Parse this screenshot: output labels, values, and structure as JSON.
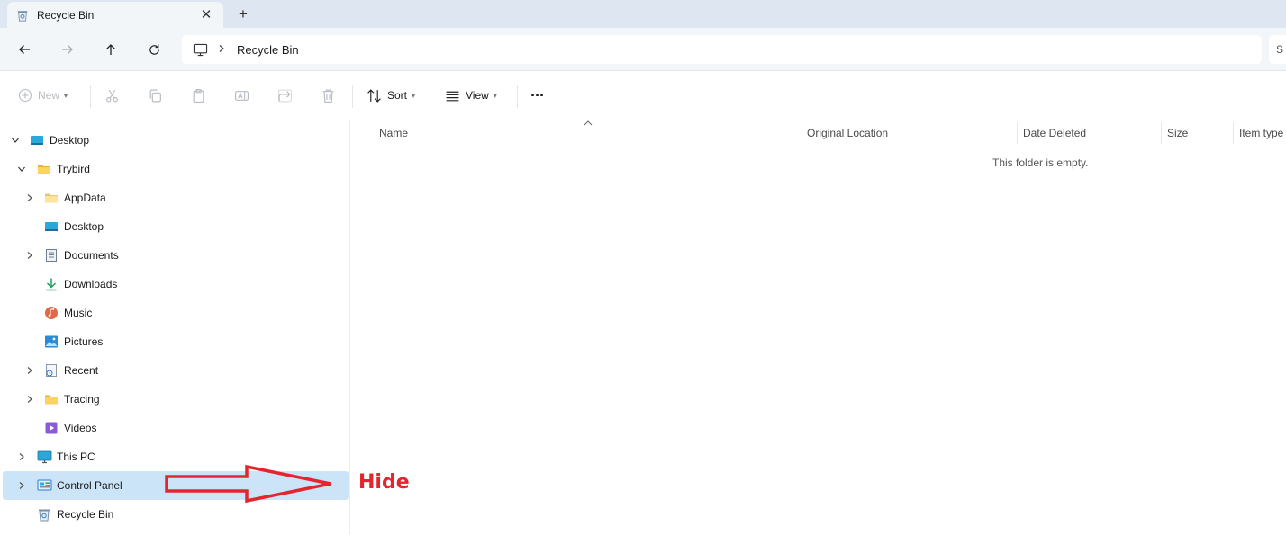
{
  "tab": {
    "title": "Recycle Bin",
    "icon": "recycle-bin-icon",
    "close_glyph": "✕",
    "new_tab_glyph": "+"
  },
  "address": {
    "crumb": "Recycle Bin",
    "location_icon": "monitor-icon",
    "search_partial": "S"
  },
  "toolbar": {
    "new_label": "New",
    "sort_label": "Sort",
    "view_label": "View",
    "more_glyph": "···"
  },
  "sidebar": {
    "items": [
      {
        "label": "Desktop",
        "icon": "desktop-icon",
        "expanded": true
      },
      {
        "label": "Trybird",
        "icon": "folder-icon",
        "expanded": true
      },
      {
        "label": "AppData",
        "icon": "folder-icon",
        "expandable": true
      },
      {
        "label": "Desktop",
        "icon": "desktop-icon"
      },
      {
        "label": "Documents",
        "icon": "documents-icon",
        "expandable": true
      },
      {
        "label": "Downloads",
        "icon": "download-icon"
      },
      {
        "label": "Music",
        "icon": "music-icon"
      },
      {
        "label": "Pictures",
        "icon": "pictures-icon"
      },
      {
        "label": "Recent",
        "icon": "recent-icon",
        "expandable": true
      },
      {
        "label": "Tracing",
        "icon": "folder-icon",
        "expandable": true
      },
      {
        "label": "Videos",
        "icon": "videos-icon"
      },
      {
        "label": "This PC",
        "icon": "this-pc-icon",
        "expandable": true
      },
      {
        "label": "Control Panel",
        "icon": "control-panel-icon",
        "expandable": true,
        "selected": true
      },
      {
        "label": "Recycle Bin",
        "icon": "recycle-bin-icon"
      }
    ]
  },
  "columns": {
    "name": "Name",
    "original_location": "Original Location",
    "date_deleted": "Date Deleted",
    "size": "Size",
    "item_type": "Item type"
  },
  "empty_message": "This folder is empty.",
  "annotation": {
    "text": "Hide",
    "color": "#e3262e"
  },
  "colors": {
    "selection": "#cce4f7",
    "accent": "#0067c0",
    "title_bar": "#dde6f1"
  }
}
